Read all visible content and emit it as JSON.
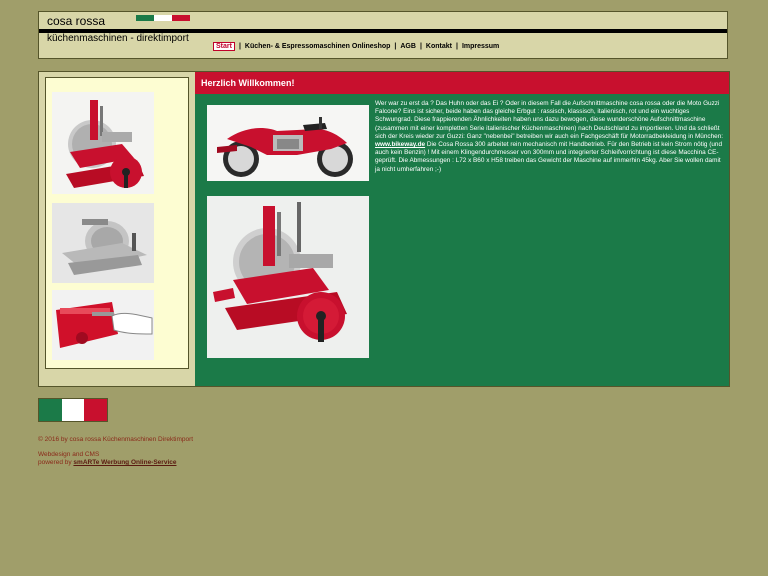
{
  "header": {
    "brand_title": "cosa rossa",
    "brand_subtitle": "küchenmaschinen - direktimport",
    "flag_colors": [
      "#1b7a48",
      "#ffffff",
      "#c8102e"
    ]
  },
  "nav": {
    "items": [
      {
        "label": "Start",
        "active": true
      },
      {
        "label": "Küchen- & Espressomaschinen Onlineshop"
      },
      {
        "label": "AGB"
      },
      {
        "label": "Kontakt"
      },
      {
        "label": "Impressum"
      }
    ],
    "separator": "|"
  },
  "content": {
    "heading": "Herzlich Willkommen!",
    "paragraph_before_link": "Wer war zu erst da ? Das Huhn oder das Ei ? Oder in diesem Fall die Aufschnittmaschine cosa rossa oder die Moto Guzzi Falcone? Eins ist sicher, beide haben das gleiche Erbgut : rassisch, klassisch, italienisch, rot und ein wuchtiges Schwungrad. Diese frappierenden Ähnlichkeiten haben uns dazu bewogen, diese wunderschöne Aufschnittmaschine (zusammen mit einer kompletten Serie italienischer Küchenmaschinen) nach Deutschland zu importieren. Und da schließt sich der Kreis wieder zur Guzzi: Ganz \"nebenbei\" betreiben wir auch ein Fachgeschäft für Motorradbekleidung in München:",
    "link_text": "www.bikeway.de",
    "paragraph_after_link": "Die Cosa Rossa 300 arbeitet rein mechanisch mit Handbetrieb. Für den Betrieb ist kein Strom nötig (und auch kein Benzin) ! Mit einem Klingendurchmesser von 300mm und integrierter Schleifvorrichtung ist diese Macchina CE-geprüft. Die Abmessungen : L72 x B60 x H58 treiben das Gewicht der Maschine auf immerhin 45kg. Aber Sie wollen damit ja nicht umherfahren ;-)"
  },
  "footer": {
    "copyright": "© 2016 by cosa rossa Küchenmaschinen Direktimport",
    "webdesign_line": "Webdesign and CMS",
    "powered_prefix": "powered by",
    "powered_link": "smARTe Werbung Online-Service"
  },
  "colors": {
    "background": "#a09e6a",
    "panel": "#d8d6a8",
    "content_green": "#1b7a48",
    "accent_red": "#c8102e"
  }
}
